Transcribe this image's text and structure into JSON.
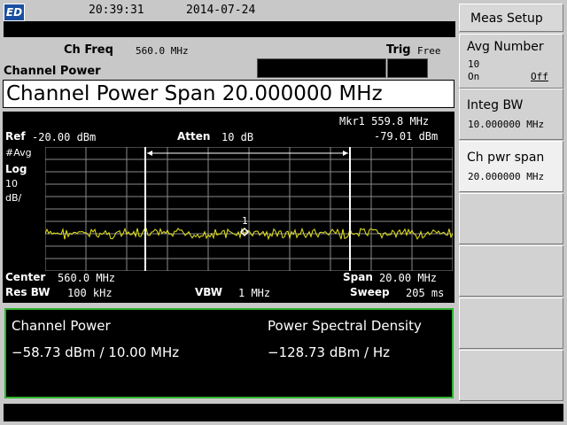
{
  "status": {
    "logo": "ED",
    "time": "20:39:31",
    "date": "2014-07-24"
  },
  "header": {
    "ch_freq_label": "Ch Freq",
    "ch_freq_value": "560.0 MHz",
    "trig_label": "Trig",
    "trig_value": "Free",
    "mode": "Channel Power"
  },
  "span_title": "Channel Power Span  20.000000 MHz",
  "screen": {
    "marker_line1": "Mkr1 559.8 MHz",
    "marker_line2": "-79.01 dBm",
    "ref_label": "Ref",
    "ref_value": "-20.00 dBm",
    "atten_label": "Atten",
    "atten_value": "10 dB",
    "avg": "#Avg",
    "scale_label": "Log",
    "scale_value": "10",
    "scale_unit": "dB/",
    "marker_number": "1",
    "center_label": "Center",
    "center_value": "560.0 MHz",
    "span_label": "Span",
    "span_value": "20.00 MHz",
    "resbw_label": "Res BW",
    "resbw_value": "100 kHz",
    "vbw_label": "VBW",
    "vbw_value": "1 MHz",
    "sweep_label": "Sweep",
    "sweep_value": "205 ms"
  },
  "results": {
    "cp_label": "Channel Power",
    "cp_value": "−58.73 dBm / 10.00 MHz",
    "psd_label": "Power Spectral Density",
    "psd_value": "−128.73 dBm / Hz"
  },
  "softkeys": {
    "meas_setup": "Meas Setup",
    "avg_number": {
      "label": "Avg Number",
      "value": "10",
      "on": "On",
      "off": "Off"
    },
    "integ_bw": {
      "label": "Integ BW",
      "value": "10.000000 MHz"
    },
    "ch_pwr_span": {
      "label": "Ch pwr span",
      "value": "20.000000 MHz"
    }
  },
  "colors": {
    "trace": "#e6e61e",
    "result_border": "#2db22d",
    "graticule": "#8a8a8a"
  }
}
